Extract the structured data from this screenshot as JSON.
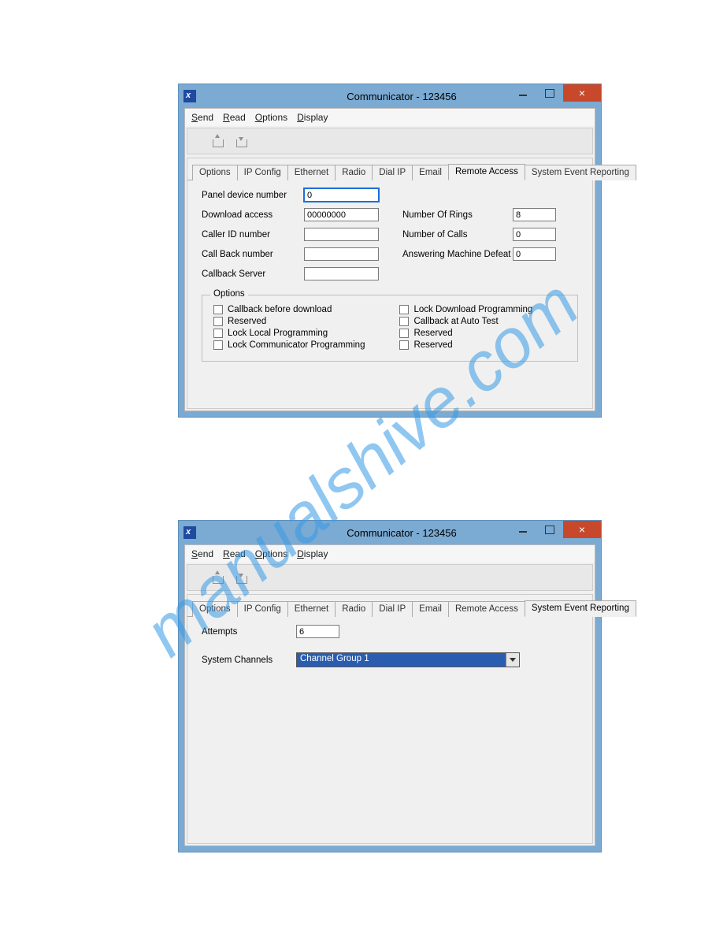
{
  "watermark": "manualshive.com",
  "window": {
    "title": "Communicator - 123456",
    "menus": [
      "Send",
      "Read",
      "Options",
      "Display"
    ],
    "tabs": [
      "Options",
      "IP Config",
      "Ethernet",
      "Radio",
      "Dial IP",
      "Email",
      "Remote Access",
      "System Event Reporting"
    ]
  },
  "win1": {
    "active_tab": "Remote Access",
    "fields": {
      "panel_device_number_label": "Panel device number",
      "panel_device_number_value": "0",
      "download_access_label": "Download access",
      "download_access_value": "00000000",
      "caller_id_label": "Caller ID number",
      "caller_id_value": "",
      "callback_number_label": "Call Back number",
      "callback_number_value": "",
      "callback_server_label": "Callback Server",
      "callback_server_value": "",
      "number_of_rings_label": "Number Of Rings",
      "number_of_rings_value": "8",
      "number_of_calls_label": "Number of Calls",
      "number_of_calls_value": "0",
      "amd_label": "Answering Machine Defeat",
      "amd_value": "0"
    },
    "options_title": "Options",
    "options_left": [
      "Callback before download",
      "Reserved",
      "Lock Local Programming",
      "Lock Communicator Programming"
    ],
    "options_right": [
      "Lock Download Programming",
      "Callback at Auto Test",
      "Reserved",
      "Reserved"
    ]
  },
  "win2": {
    "active_tab": "System Event Reporting",
    "attempts_label": "Attempts",
    "attempts_value": "6",
    "system_channels_label": "System Channels",
    "system_channels_value": "Channel Group 1"
  }
}
